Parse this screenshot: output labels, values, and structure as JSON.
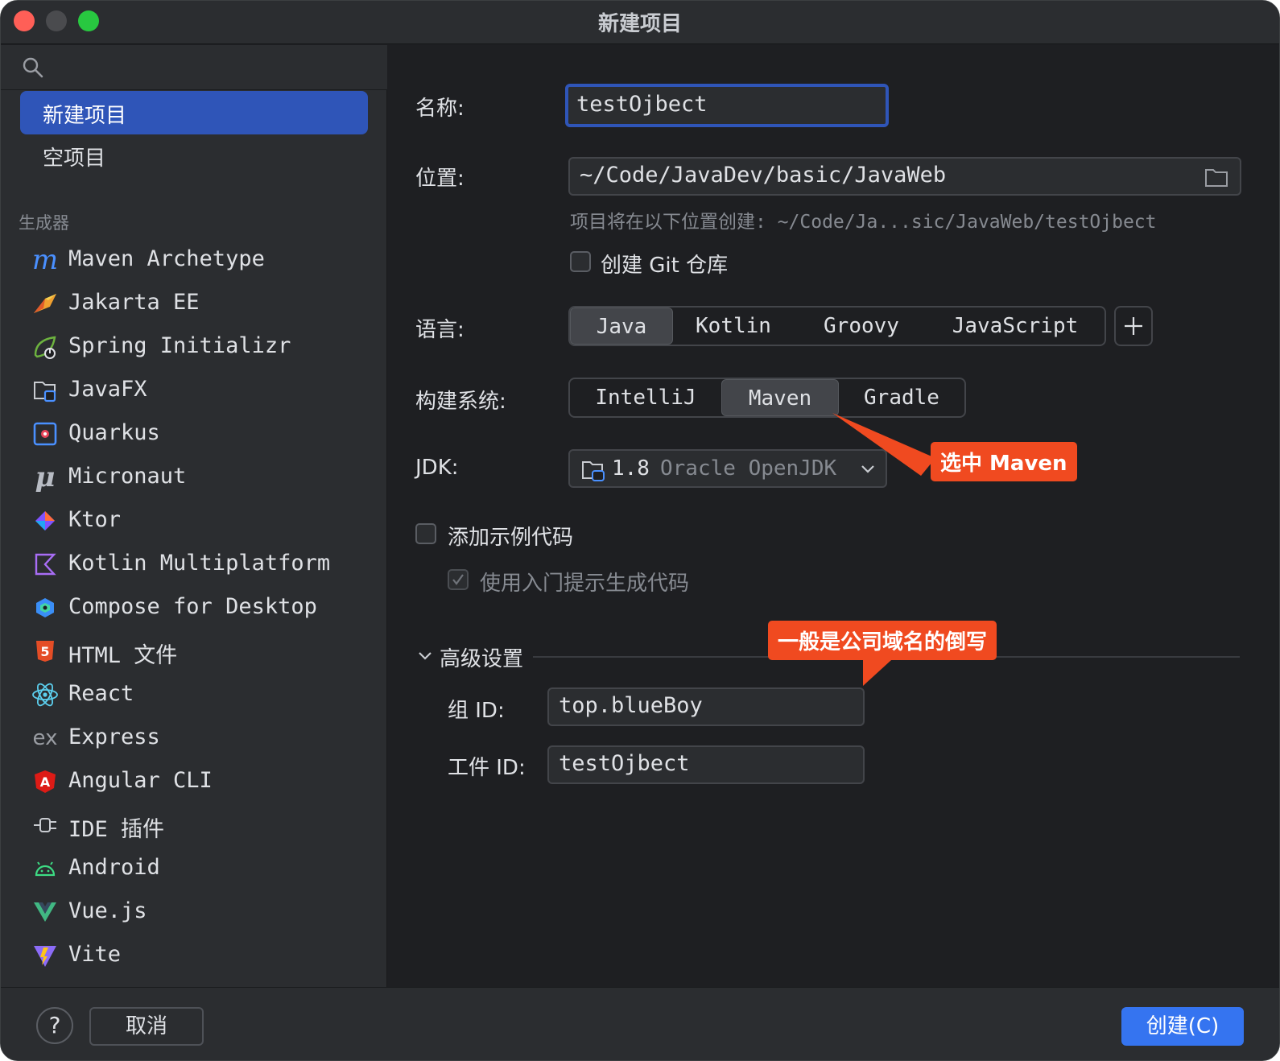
{
  "window": {
    "title": "新建项目"
  },
  "sidebar": {
    "search_placeholder": "",
    "top_items": [
      {
        "label": "新建项目",
        "selected": true
      },
      {
        "label": "空项目",
        "selected": false
      }
    ],
    "group_label": "生成器",
    "generators": [
      {
        "label": "Maven Archetype",
        "icon": "maven-icon"
      },
      {
        "label": "Jakarta EE",
        "icon": "jakarta-ee-icon"
      },
      {
        "label": "Spring Initializr",
        "icon": "spring-icon"
      },
      {
        "label": "JavaFX",
        "icon": "javafx-icon"
      },
      {
        "label": "Quarkus",
        "icon": "quarkus-icon"
      },
      {
        "label": "Micronaut",
        "icon": "micronaut-icon"
      },
      {
        "label": "Ktor",
        "icon": "ktor-icon"
      },
      {
        "label": "Kotlin Multiplatform",
        "icon": "kotlin-multiplatform-icon"
      },
      {
        "label": "Compose for Desktop",
        "icon": "compose-icon"
      },
      {
        "label": "HTML 文件",
        "icon": "html5-icon"
      },
      {
        "label": "React",
        "icon": "react-icon"
      },
      {
        "label": "Express",
        "icon": "express-icon"
      },
      {
        "label": "Angular CLI",
        "icon": "angular-icon"
      },
      {
        "label": "IDE 插件",
        "icon": "plugin-icon"
      },
      {
        "label": "Android",
        "icon": "android-icon"
      },
      {
        "label": "Vue.js",
        "icon": "vue-icon"
      },
      {
        "label": "Vite",
        "icon": "vite-icon"
      }
    ]
  },
  "form": {
    "name_label": "名称:",
    "name_value": "testOjbect",
    "location_label": "位置:",
    "location_value": "~/Code/JavaDev/basic/JavaWeb",
    "location_hint": "项目将在以下位置创建: ~/Code/Ja...sic/JavaWeb/testOjbect",
    "git_label": "创建 Git 仓库",
    "git_checked": false,
    "language_label": "语言:",
    "languages": [
      "Java",
      "Kotlin",
      "Groovy",
      "JavaScript"
    ],
    "language_selected": "Java",
    "build_label": "构建系统:",
    "build_systems": [
      "IntelliJ",
      "Maven",
      "Gradle"
    ],
    "build_selected": "Maven",
    "jdk_label": "JDK:",
    "jdk_version": "1.8",
    "jdk_vendor": "Oracle OpenJDK",
    "sample_code_label": "添加示例代码",
    "sample_code_checked": false,
    "onboarding_label": "使用入门提示生成代码",
    "onboarding_checked": true,
    "advanced_label": "高级设置",
    "group_id_label": "组 ID:",
    "group_id_value": "top.blueBoy",
    "artifact_id_label": "工件 ID:",
    "artifact_id_value": "testOjbect"
  },
  "annotations": {
    "maven_note": "选中 Maven",
    "groupid_note": "一般是公司域名的倒写"
  },
  "footer": {
    "help_label": "?",
    "cancel_label": "取消",
    "create_label": "创建(C)"
  },
  "colors": {
    "accent": "#3574f0",
    "selected_sidebar": "#2f55b8",
    "annotation": "#f04a20",
    "background": "#1e1f22",
    "panel": "#2b2d30"
  }
}
